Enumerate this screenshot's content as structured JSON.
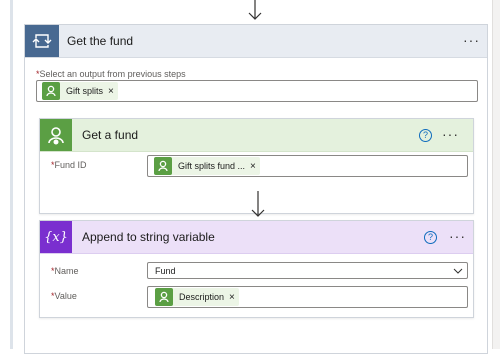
{
  "outer": {
    "title": "Get the fund",
    "more": "···"
  },
  "select_label": "Select an output from previous steps",
  "selected_token": {
    "label": "Gift splits",
    "remove": "×"
  },
  "card_get_fund": {
    "title": "Get a fund",
    "help": "?",
    "more": "···",
    "fund_id_label": "Fund ID",
    "fund_id_token": {
      "label": "Gift splits fund ...",
      "remove": "×"
    }
  },
  "card_append": {
    "title": "Append to string variable",
    "icon_text": "{x}",
    "help": "?",
    "more": "···",
    "name_label": "Name",
    "name_value": "Fund",
    "value_label": "Value",
    "value_token": {
      "label": "Description",
      "remove": "×"
    }
  },
  "required_mark": "*",
  "colors": {
    "loop_blue": "#486991",
    "fund_green": "#5b9f44",
    "variable_purple": "#7a2fcf",
    "link_blue": "#0f6cbd"
  }
}
